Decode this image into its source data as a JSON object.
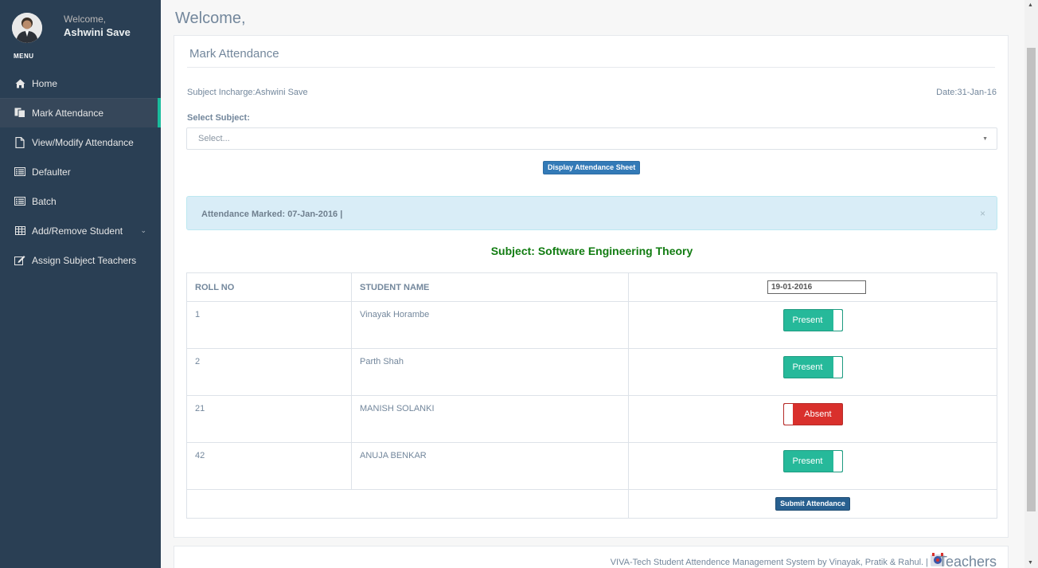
{
  "sidebar": {
    "welcome": "Welcome,",
    "user_name": "Ashwini Save",
    "menu_label": "MENU",
    "items": [
      {
        "label": "Home",
        "icon": "home-icon"
      },
      {
        "label": "Mark Attendance",
        "icon": "copy-icon"
      },
      {
        "label": "View/Modify Attendance",
        "icon": "file-icon"
      },
      {
        "label": "Defaulter",
        "icon": "list-icon"
      },
      {
        "label": "Batch",
        "icon": "list-icon"
      },
      {
        "label": "Add/Remove Student",
        "icon": "table-icon"
      },
      {
        "label": "Assign Subject Teachers",
        "icon": "edit-icon"
      }
    ],
    "active_item": "Mark Attendance"
  },
  "page": {
    "title": "Welcome,",
    "panel_title": "Mark Attendance",
    "incharge": "Subject Incharge:Ashwini Save",
    "date": "Date:31-Jan-16",
    "select_label": "Select Subject:",
    "select_placeholder": "Select...",
    "display_button": "Display Attendance Sheet",
    "alert": "Attendance Marked: 07-Jan-2016 |",
    "alert_close": "×",
    "subject_heading": "Subject: Software Engineering Theory"
  },
  "table": {
    "headers": {
      "roll": "ROLL NO",
      "name": "STUDENT NAME",
      "date": "19-01-2016"
    },
    "rows": [
      {
        "roll": "1",
        "name": "Vinayak Horambe",
        "status": "Present"
      },
      {
        "roll": "2",
        "name": "Parth Shah",
        "status": "Present"
      },
      {
        "roll": "21",
        "name": "MANISH SOLANKI",
        "status": "Absent"
      },
      {
        "roll": "42",
        "name": "ANUJA BENKAR",
        "status": "Present"
      }
    ],
    "submit_button": "Submit Attendance"
  },
  "footer": {
    "text": "VIVA-Tech Student Attendence Management System by Vinayak, Pratik & Rahul. |",
    "brand": "Teachers"
  },
  "colors": {
    "sidebar_bg": "#2a3f54",
    "present": "#26b99a",
    "absent": "#d9302c",
    "primary_button": "#337ab7",
    "subject_heading": "#117c11",
    "alert_bg": "#d9edf7"
  }
}
